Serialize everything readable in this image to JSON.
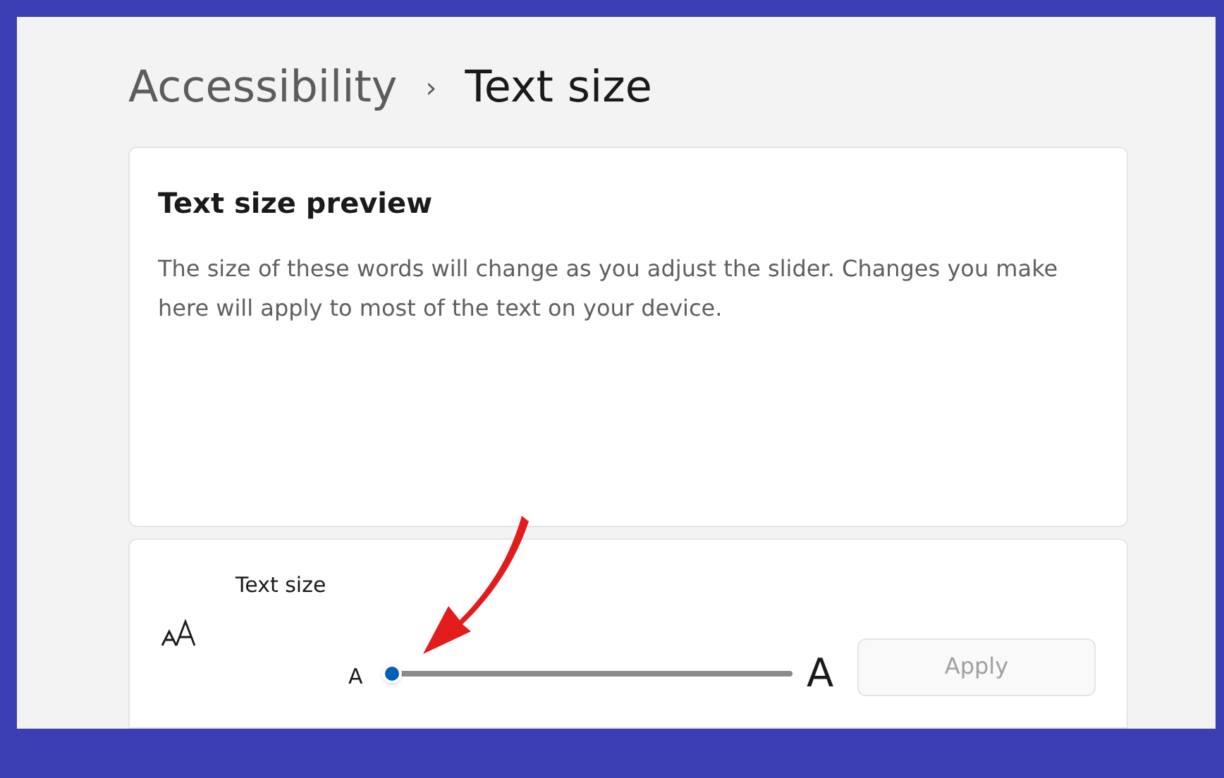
{
  "breadcrumb": {
    "parent": "Accessibility",
    "separator": "›",
    "current": "Text size"
  },
  "preview": {
    "title": "Text size preview",
    "description": "The size of these words will change as you adjust the slider. Changes you make here will apply to most of the text on your device."
  },
  "text_size": {
    "label": "Text size",
    "min_label": "A",
    "max_label": "A",
    "level": 0,
    "apply": {
      "label": "Apply",
      "disabled": true
    }
  }
}
